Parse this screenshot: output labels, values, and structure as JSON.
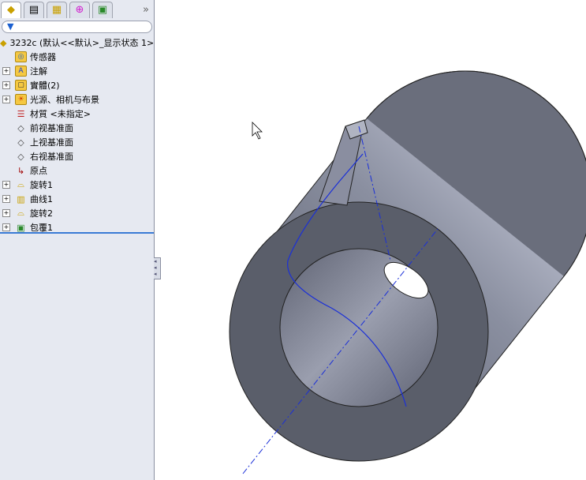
{
  "tabs": [
    {
      "name": "feature-manager",
      "icon": "part-icon"
    },
    {
      "name": "property-manager",
      "icon": "property-icon"
    },
    {
      "name": "configuration-manager",
      "icon": "config-icon"
    },
    {
      "name": "dimxpert",
      "icon": "target-icon"
    },
    {
      "name": "display-manager",
      "icon": "display-icon"
    }
  ],
  "more_label": "»",
  "tree": {
    "root": "3232c  (默认<<默认>_显示状态 1>",
    "items": [
      {
        "label": "传感器",
        "icon": "sensor-icon",
        "expandable": false
      },
      {
        "label": "注解",
        "icon": "annotation-icon",
        "expandable": true
      },
      {
        "label": "實體(2)",
        "icon": "solid-bodies-icon",
        "expandable": true
      },
      {
        "label": "光源、相机与布景",
        "icon": "lights-icon",
        "expandable": true
      },
      {
        "label": "材質 <未指定>",
        "icon": "material-icon",
        "expandable": false
      },
      {
        "label": "前视基准面",
        "icon": "plane-icon",
        "expandable": false
      },
      {
        "label": "上视基准面",
        "icon": "plane-icon",
        "expandable": false
      },
      {
        "label": "右视基准面",
        "icon": "plane-icon",
        "expandable": false
      },
      {
        "label": "原点",
        "icon": "origin-icon",
        "expandable": false
      },
      {
        "label": "旋转1",
        "icon": "revolve-icon",
        "expandable": true
      },
      {
        "label": "曲线1",
        "icon": "curve-icon",
        "expandable": true
      },
      {
        "label": "旋转2",
        "icon": "revolve-icon",
        "expandable": true
      },
      {
        "label": "包覆1",
        "icon": "wrap-icon",
        "expandable": true
      }
    ]
  },
  "colors": {
    "accent": "#3a7bd5",
    "part": "#6a6e7c",
    "curve": "#1a2fd8"
  }
}
